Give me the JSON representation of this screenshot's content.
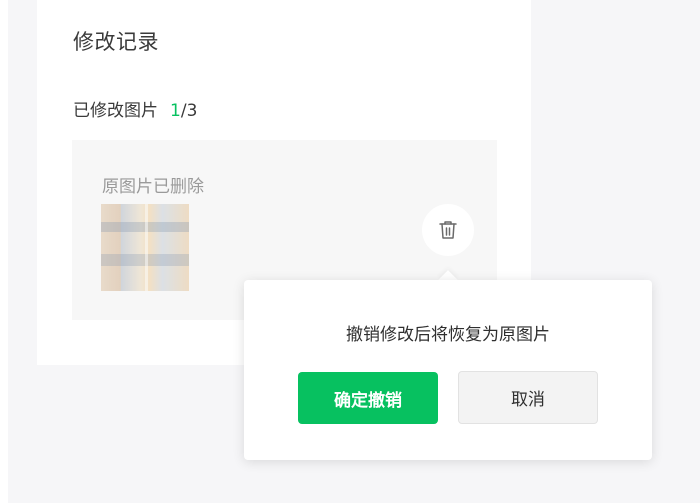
{
  "record": {
    "title": "修改记录",
    "modified_label": "已修改图片",
    "modified_current": "1",
    "modified_separator": "/",
    "modified_total": "3",
    "deleted_label": "原图片已删除",
    "delete_icon": "trash-icon"
  },
  "popover": {
    "message": "撤销修改后将恢复为原图片",
    "confirm_label": "确定撤销",
    "cancel_label": "取消"
  },
  "colors": {
    "accent": "#07c160",
    "background": "#f6f6f8",
    "card": "#ffffff"
  }
}
